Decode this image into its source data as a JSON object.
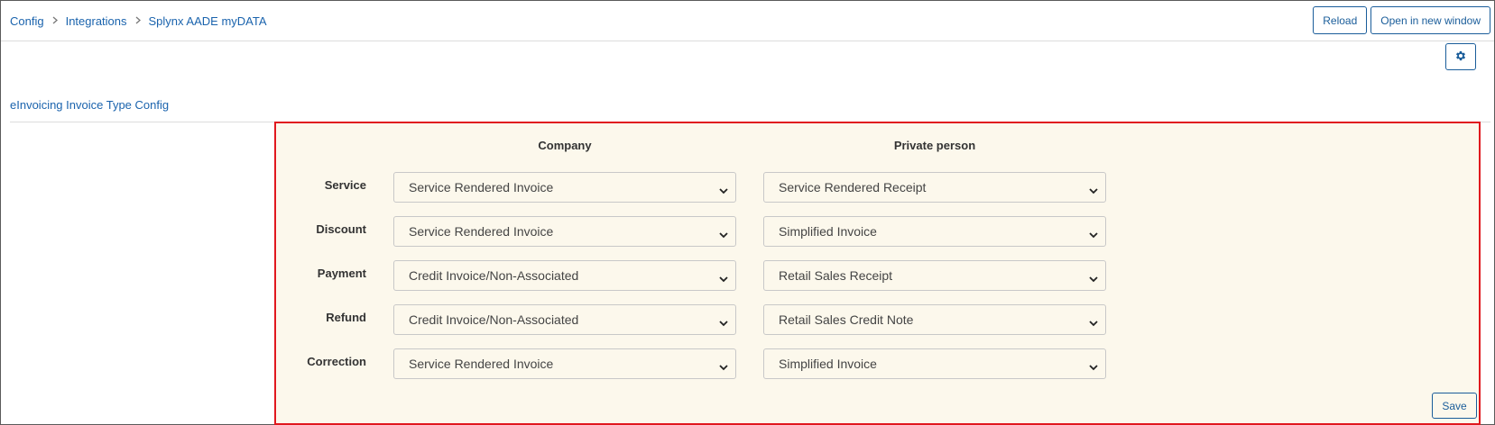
{
  "breadcrumb": [
    "Config",
    "Integrations",
    "Splynx AADE myDATA"
  ],
  "toolbar": {
    "reload_label": "Reload",
    "open_new_window_label": "Open in new window"
  },
  "section": {
    "title": "eInvoicing Invoice Type Config"
  },
  "columns": {
    "company": "Company",
    "private": "Private person"
  },
  "rows": [
    {
      "label": "Service",
      "company": "Service Rendered Invoice",
      "private": "Service Rendered Receipt"
    },
    {
      "label": "Discount",
      "company": "Service Rendered Invoice",
      "private": "Simplified Invoice"
    },
    {
      "label": "Payment",
      "company": "Credit Invoice/Non-Associated",
      "private": "Retail Sales Receipt"
    },
    {
      "label": "Refund",
      "company": "Credit Invoice/Non-Associated",
      "private": "Retail Sales Credit Note"
    },
    {
      "label": "Correction",
      "company": "Service Rendered Invoice",
      "private": "Simplified Invoice"
    }
  ],
  "save_label": "Save",
  "icons": {
    "settings": "gear-icon",
    "crumb_separator": "chevron-right-icon",
    "select_arrow": "chevron-down-icon"
  },
  "colors": {
    "link": "#1a63ad",
    "panel_bg": "#fcf8ec",
    "highlight_border": "#e0181e",
    "button_border": "#1a5d9a"
  }
}
